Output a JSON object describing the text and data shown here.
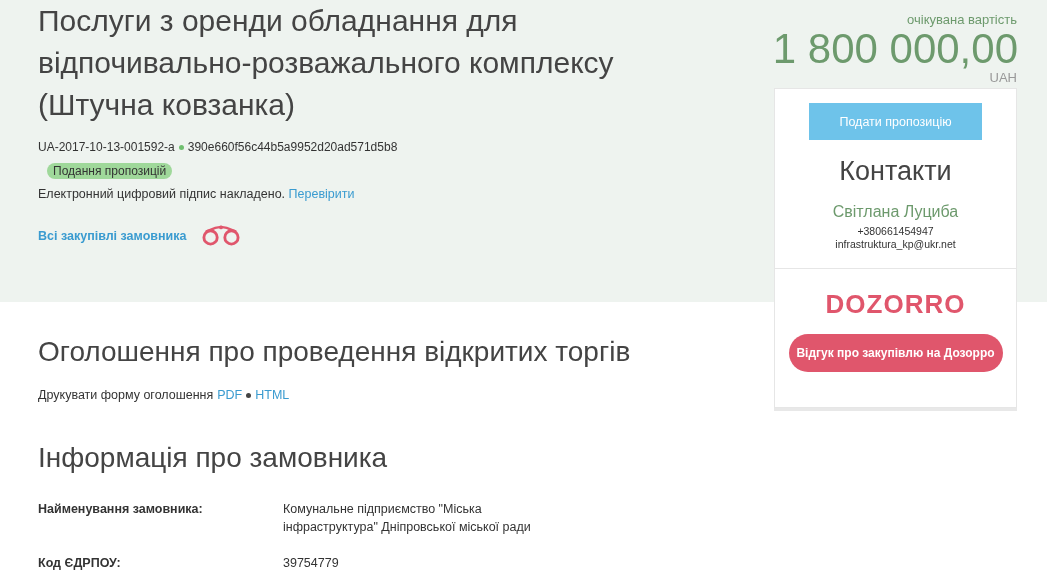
{
  "tender": {
    "title": "Послуги з оренди обладнання для відпочивально-розважального комплексу (Штучна ковзанка)",
    "id": "UA-2017-10-13-001592-a",
    "hash": "390e660f56c44b5a9952d20ad571d5b8",
    "status": "Подання пропозицій",
    "signature_text": "Електронний цифровий підпис накладено.",
    "signature_link": "Перевірити",
    "all_purchases_link": "Всі закупівлі замовника"
  },
  "price": {
    "label": "очікувана вартість",
    "amount": "1 800 000,00",
    "currency": "UAH"
  },
  "sidebar": {
    "submit_button": "Подати пропозицію",
    "contacts_title": "Контакти",
    "contact_name": "Світлана Луциба",
    "phone": "+380661454947",
    "email": "infrastruktura_kp@ukr.net",
    "logo": "DOZORRO",
    "feedback_button": "Відгук про закупівлю на Дозорро"
  },
  "announcement": {
    "title": "Оголошення про проведення відкритих торгів",
    "print_label": "Друкувати форму оголошення",
    "links": [
      "PDF",
      "HTML"
    ]
  },
  "customer": {
    "title": "Інформація про замовника",
    "rows": [
      {
        "label": "Найменування замовника:",
        "value": "Комунальне підприємство \"Міська інфраструктура\" Дніпровської міської ради"
      },
      {
        "label": "Код ЄДРПОУ:",
        "value": "39754779"
      }
    ]
  }
}
